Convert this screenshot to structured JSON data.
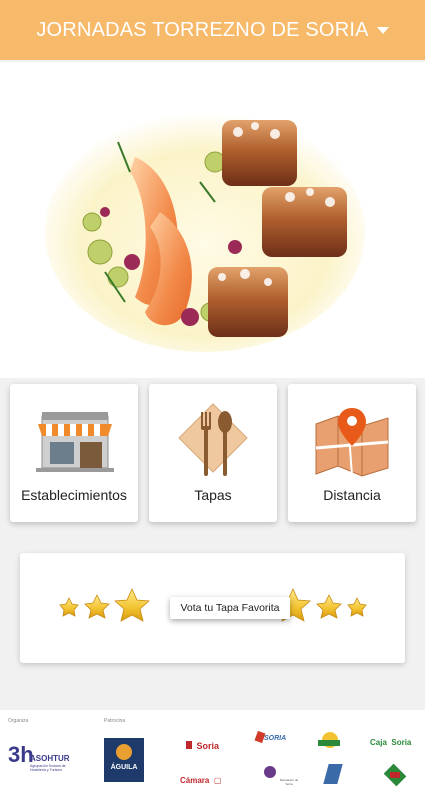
{
  "header": {
    "title": "JORNADAS TORREZNO DE SORIA"
  },
  "hero": {
    "image": "plato-torrezno-gambas"
  },
  "tiles": [
    {
      "label": "Establecimientos",
      "icon": "storefront-icon"
    },
    {
      "label": "Tapas",
      "icon": "fork-spoon-icon"
    },
    {
      "label": "Distancia",
      "icon": "map-pin-icon"
    }
  ],
  "vote": {
    "label": "Vota tu Tapa Favorita",
    "icon": "star-icon"
  },
  "footer": {
    "caption_left": "Organiza",
    "caption_mid": "Patrocina",
    "sponsors": {
      "asohtur": "ASOHTUR",
      "asohtur_sub": "Agrupación Soriana de Hostelería y Turismo",
      "aguila": "ÁGUILA",
      "soria": "Soria",
      "camara": "Cámara",
      "diputacion": "Diputación de Soria",
      "soria_ni": "SORIA",
      "caja": "Caja",
      "caja_soria": "Soria"
    }
  },
  "colors": {
    "accent": "#f7b96a",
    "star": "#f2c230"
  }
}
